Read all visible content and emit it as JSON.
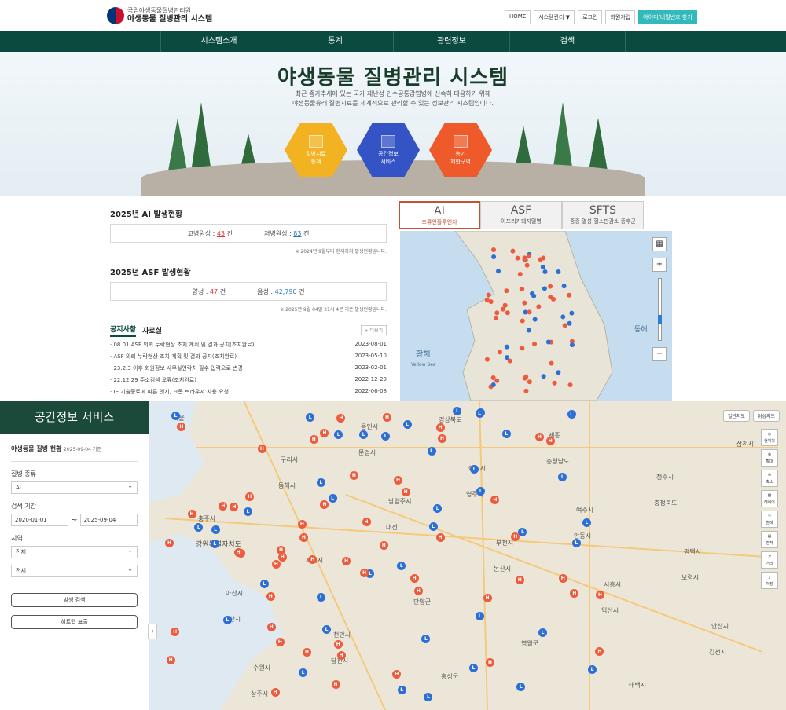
{
  "header": {
    "org": "국립야생동물질병관리원",
    "title": "야생동물 질병관리 시스템",
    "util": [
      "HOME",
      "시스템관리 ▼",
      "로그인",
      "회원가입"
    ],
    "find": "아이디/비밀번호 찾기"
  },
  "gnb": [
    "시스템소개",
    "통계",
    "관련정보",
    "검색"
  ],
  "hero": {
    "title": "야생동물 질병관리 시스템",
    "sub1": "최근 증가추세에 있는 국가 재난성 인수공통감염병에 신속히 대응하기 위해",
    "sub2": "야생동물유래 질병시료를 체계적으로 관리할 수 있는 정보관리 시스템입니다.",
    "hex": [
      {
        "l1": "질병시료",
        "l2": "통계"
      },
      {
        "l1": "공간정보",
        "l2": "서비스"
      },
      {
        "l1": "총기",
        "l2": "제한구역"
      }
    ]
  },
  "ai": {
    "title": "2025년 AI 발생현황",
    "high_label": "고병원성 :",
    "high_val": "43",
    "low_label": "저병원성 :",
    "low_val": "83",
    "unit": "건",
    "note": "※ 2024년 9월부터 현재까지 발생현황입니다."
  },
  "asf": {
    "title": "2025년 ASF 발생현황",
    "pos_label": "양성 :",
    "pos_val": "47",
    "neg_label": "음성 :",
    "neg_val": "42,790",
    "unit": "건",
    "note": "※ 2025년 9월 04일 21시 4분 기준 발생현황입니다."
  },
  "board": {
    "tab1": "공지사항",
    "tab2": "자료실",
    "more": "+ 더보기",
    "items": [
      {
        "t": "· 08.01 ASF 의뢰 누락현상 조치 계획 및 결과 공지(조치완료)",
        "d": "2023-08-01"
      },
      {
        "t": "· ASF 의뢰 누락현상 조치 계획 및 결과 공지(조치완료)",
        "d": "2023-05-10"
      },
      {
        "t": "· 23.2.3 이후 회원정보 사무실연락처 필수 입력으로 변경",
        "d": "2023-02-01"
      },
      {
        "t": "· 22.12.29 주소검색 오류(조치완료)",
        "d": "2022-12-29"
      },
      {
        "t": "· IE 기술종료에 따른 엣지, 크롬 브라우저 사용 요청",
        "d": "2022-06-08"
      }
    ]
  },
  "dtabs": [
    {
      "a": "AI",
      "b": "조류인플루엔자"
    },
    {
      "a": "ASF",
      "b": "아프리카돼지열병"
    },
    {
      "a": "SFTS",
      "b": "중증 열성 혈소판감소 증후군"
    }
  ],
  "minimap": {
    "labels": [
      "황해",
      "Yellow Sea",
      "동해"
    ]
  },
  "side": {
    "title": "공간정보 서비스",
    "sub": "야생동물 질병 현황",
    "date": "2025-09-04 기준",
    "kind_label": "질병 종류",
    "kind": "AI",
    "period_label": "검색 기간",
    "from": "2020-01-01",
    "to": "2025-09-04",
    "region_label": "지역",
    "r1": "전체",
    "r2": "전체",
    "btn1": "발생 검색",
    "btn2": "히트맵 표출"
  },
  "bigmap": {
    "tabs": [
      "일반지도",
      "위성지도"
    ],
    "tools": [
      "현위치",
      "확대",
      "축소",
      "레이어",
      "범례",
      "면적",
      "거리",
      "저장"
    ],
    "labels": [
      "서울",
      "구리시",
      "남양주시",
      "부천시",
      "시흥시",
      "안산시",
      "수원시",
      "용인시",
      "이천시",
      "여주시",
      "평택시",
      "아산시",
      "천안시",
      "홍성군",
      "세종",
      "청주시",
      "충주시",
      "제천시",
      "단양군",
      "영월군",
      "태백시",
      "삼척시",
      "동해시",
      "대전",
      "논산시",
      "익산시",
      "김천시",
      "상주시",
      "문경시",
      "영주시",
      "안동시",
      "보령시",
      "서산시",
      "당진시",
      "경상북도",
      "충청남도",
      "충청북도",
      "강원특별자치도"
    ]
  },
  "colors": {
    "primary": "#0b4a3e",
    "ai_marker": "#2c6fd6",
    "asf_marker": "#ee5a3c"
  }
}
